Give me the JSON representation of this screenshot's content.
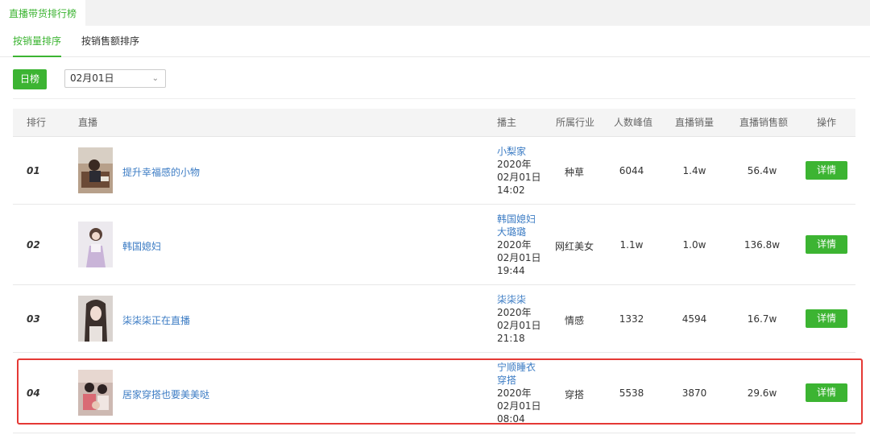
{
  "top_tab": "直播带货排行榜",
  "sub_tabs": [
    "按销量排序",
    "按销售额排序"
  ],
  "day_button": "日榜",
  "date_select": {
    "value": "02月01日"
  },
  "columns": [
    "排行",
    "直播",
    "播主",
    "所属行业",
    "人数峰值",
    "直播销量",
    "直播销售额",
    "操作"
  ],
  "detail_label": "详情",
  "rows": [
    {
      "rank": "01",
      "title": "提升幸福感的小物",
      "host": "小梨家",
      "date1": "2020年",
      "date2": "02月01日",
      "time": "14:02",
      "industry": "种草",
      "peak": "6044",
      "sales": "1.4w",
      "amount": "56.4w"
    },
    {
      "rank": "02",
      "title": "韩国媳妇",
      "host1": "韩国媳妇",
      "host2": "大璐璐",
      "date1": "2020年",
      "date2": "02月01日",
      "time": "19:44",
      "industry": "网红美女",
      "peak": "1.1w",
      "sales": "1.0w",
      "amount": "136.8w"
    },
    {
      "rank": "03",
      "title": "柒柒柒正在直播",
      "host": "柒柒柒",
      "date1": "2020年",
      "date2": "02月01日",
      "time": "21:18",
      "industry": "情感",
      "peak": "1332",
      "sales": "4594",
      "amount": "16.7w"
    },
    {
      "rank": "04",
      "title": "居家穿搭也要美美哒",
      "host1": "宁顺睡衣",
      "host2": "穿搭",
      "date1": "2020年",
      "date2": "02月01日",
      "time": "08:04",
      "industry": "穿搭",
      "peak": "5538",
      "sales": "3870",
      "amount": "29.6w"
    }
  ],
  "colors": {
    "accent": "#3cb432",
    "link": "#3c7cc4",
    "highlight": "#e53935"
  }
}
